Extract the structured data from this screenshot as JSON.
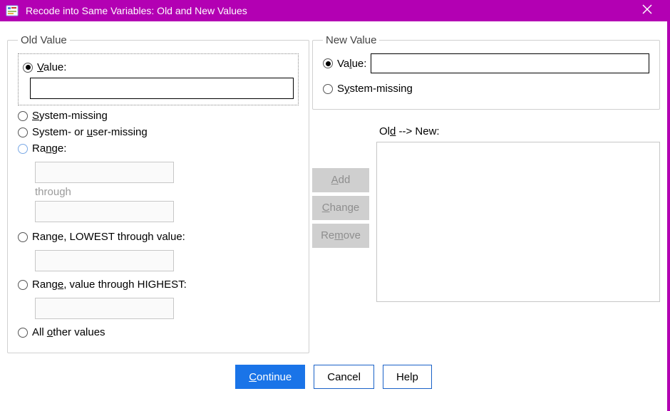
{
  "titlebar": {
    "title": "Recode into Same Variables: Old and New Values"
  },
  "oldValue": {
    "legend": "Old Value",
    "value": {
      "label_pre": "V",
      "label_post": "alue:"
    },
    "systemMissing": {
      "label_pre": "S",
      "label_post": "ystem-missing"
    },
    "systemOrUserMissing": {
      "label_pre1": "System- or ",
      "label_ul": "u",
      "label_post": "ser-missing"
    },
    "range": {
      "label_pre": "Ra",
      "label_ul": "n",
      "label_post": "ge:"
    },
    "through": "through",
    "rangeLowest": {
      "label": "Range, LOWEST through value:"
    },
    "rangeHighest": {
      "label_pre": "Rang",
      "label_ul": "e",
      "label_post": ", value through HIGHEST:"
    },
    "allOther": {
      "label_pre": "All ",
      "label_ul": "o",
      "label_post": "ther values"
    }
  },
  "newValue": {
    "legend": "New Value",
    "value": {
      "label_pre": "Va",
      "label_ul": "l",
      "label_post": "ue:"
    },
    "systemMissing": {
      "label_pre": "S",
      "label_ul": "y",
      "label_post": "stem-missing"
    }
  },
  "mapping": {
    "label_pre": "Ol",
    "label_ul": "d",
    "label_post": " --> New:",
    "add": {
      "ul": "A",
      "rest": "dd"
    },
    "change": {
      "ul": "C",
      "rest": "hange"
    },
    "remove": {
      "pre": "Re",
      "ul": "m",
      "post": "ove"
    }
  },
  "footer": {
    "continue": {
      "ul": "C",
      "rest": "ontinue"
    },
    "cancel": "Cancel",
    "help": "Help"
  }
}
